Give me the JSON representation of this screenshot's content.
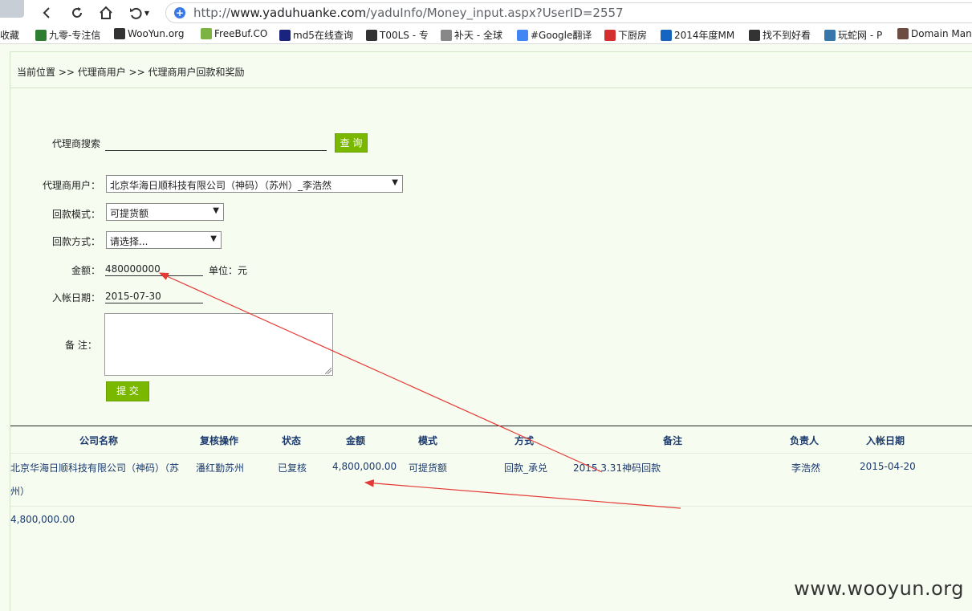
{
  "browser": {
    "url_prefix": "http://",
    "url_host": "www.yaduhuanke.com",
    "url_path": "/yaduInfo/Money_input.aspx?UserID=2557",
    "bookmarks": [
      {
        "label": "收藏",
        "icon": "star-icon",
        "color": "#f2b600"
      },
      {
        "label": "九零-专注信",
        "icon": "leaf-icon",
        "color": "#2e7d32"
      },
      {
        "label": "WooYun.org",
        "icon": "wooyun-icon",
        "color": "#333333"
      },
      {
        "label": "FreeBuf.CO",
        "icon": "freebuf-icon",
        "color": "#7cb342"
      },
      {
        "label": "md5在线查询",
        "icon": "grid-icon",
        "color": "#1a237e"
      },
      {
        "label": "T00LS - 专",
        "icon": "tools-icon",
        "color": "#333333"
      },
      {
        "label": "补天 - 全球",
        "icon": "sky-icon",
        "color": "#888888"
      },
      {
        "label": "#Google翻译",
        "icon": "translate-icon",
        "color": "#4285f4"
      },
      {
        "label": "下厨房",
        "icon": "kitchen-icon",
        "color": "#d32f2f"
      },
      {
        "label": "2014年度MM",
        "icon": "play-icon",
        "color": "#1565c0"
      },
      {
        "label": "找不到好看",
        "icon": "w-icon",
        "color": "#333333"
      },
      {
        "label": "玩蛇网 - P",
        "icon": "python-icon",
        "color": "#3776ab"
      },
      {
        "label": "Domain Man",
        "icon": "domain-icon",
        "color": "#6d4c41"
      }
    ]
  },
  "breadcrumb": "当前位置 >> 代理商用户 >> 代理商用户回款和奖励",
  "search": {
    "label": "代理商搜索",
    "value": "",
    "button": "查 询"
  },
  "form": {
    "agent_label": "代理商用户：",
    "agent_value": "北京华海日顺科技有限公司（神码）（苏州）_李浩然",
    "mode_label": "回款模式：",
    "mode_value": "可提货额",
    "method_label": "回款方式：",
    "method_value": "请选择...",
    "amount_label": "金额：",
    "amount_value": "480000000",
    "amount_unit": "单位：元",
    "date_label": "入帐日期：",
    "date_value": "2015-07-30",
    "note_label": "备  注：",
    "submit": "提 交"
  },
  "table": {
    "headers": [
      "公司名称",
      "复核操作",
      "状态",
      "金额",
      "模式",
      "方式",
      "备注",
      "负责人",
      "入帐日期"
    ],
    "rows": [
      {
        "company_line1": "北京华海日顺科技有限公司（神码）（苏",
        "company_line2": "州）",
        "review": "潘红勤苏州",
        "status": "已复核",
        "amount": "4,800,000.00",
        "mode": "可提货额",
        "method": "回款_承兑",
        "note": "2015.3.31神码回款",
        "owner": "李浩然",
        "date": "2015-04-20"
      }
    ],
    "total": "4,800,000.00"
  },
  "watermark": "www.wooyun.org",
  "colors": {
    "page_bg": "#f7fcf1",
    "accent_green": "#7ab800",
    "table_text": "#1a3a6e",
    "annotation_red": "#e53935"
  }
}
